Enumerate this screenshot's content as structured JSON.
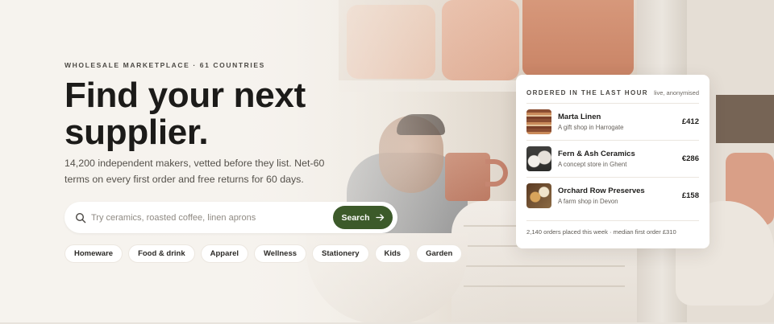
{
  "hero": {
    "eyebrow": "WHOLESALE MARKETPLACE · 61 COUNTRIES",
    "headline": "Find your next supplier.",
    "subcopy": "14,200 independent makers, vetted before they list. Net-60 terms on every first order and free returns for 60 days."
  },
  "search": {
    "icon": "search-icon",
    "placeholder": "Try ceramics, roasted coffee, linen aprons",
    "value": "",
    "button_label": "Search",
    "button_icon": "arrow-right-icon",
    "button_color": "#3c5a2a"
  },
  "categories": [
    {
      "label": "Homeware"
    },
    {
      "label": "Food & drink"
    },
    {
      "label": "Apparel"
    },
    {
      "label": "Wellness"
    },
    {
      "label": "Stationery"
    },
    {
      "label": "Kids"
    },
    {
      "label": "Garden"
    }
  ],
  "activity": {
    "title": "ORDERED IN THE LAST HOUR",
    "note": "live, anonymised",
    "orders": [
      {
        "name": "Marta Linen",
        "buyer": "A gift shop in Harrogate",
        "amount": "£412"
      },
      {
        "name": "Fern & Ash Ceramics",
        "buyer": "A concept store in Ghent",
        "amount": "€286"
      },
      {
        "name": "Orchard Row Preserves",
        "buyer": "A farm shop in Devon",
        "amount": "£158"
      }
    ],
    "footer": "2,140 orders placed this week · median first order £310"
  },
  "colors": {
    "background": "#f6f3ee",
    "text": "#1c1b19",
    "accent": "#3c5a2a"
  }
}
